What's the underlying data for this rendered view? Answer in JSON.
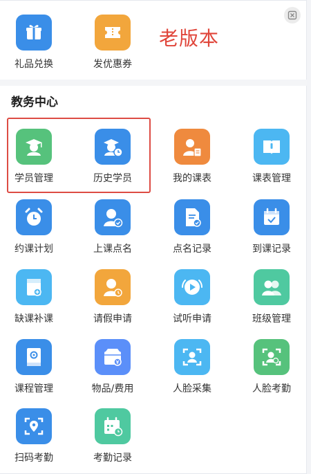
{
  "overlay": {
    "version_label": "老版本",
    "close_icon": "close-icon"
  },
  "colors": {
    "blue": "#3a8ee8",
    "sky": "#4cb7f2",
    "green": "#56c27c",
    "teal": "#4fc9a0",
    "orange": "#f2a63c",
    "deep_orange": "#ef8a3e",
    "indigo": "#5b8ff9",
    "highlight": "#dd4b43"
  },
  "top_items": [
    {
      "label": "礼品兑换",
      "icon": "gift-icon",
      "color": "#3a8ee8"
    },
    {
      "label": "发优惠券",
      "icon": "coupon-icon",
      "color": "#f2a63c"
    }
  ],
  "section": {
    "title": "教务中心",
    "items": [
      {
        "label": "学员管理",
        "icon": "student-icon",
        "color": "#56c27c"
      },
      {
        "label": "历史学员",
        "icon": "history-student-icon",
        "color": "#3a8ee8"
      },
      {
        "label": "我的课表",
        "icon": "my-schedule-icon",
        "color": "#ef8a3e"
      },
      {
        "label": "课表管理",
        "icon": "schedule-book-icon",
        "color": "#4cb7f2"
      },
      {
        "label": "约课计划",
        "icon": "alarm-clock-icon",
        "color": "#3a8ee8"
      },
      {
        "label": "上课点名",
        "icon": "attendance-user-icon",
        "color": "#3a8ee8"
      },
      {
        "label": "点名记录",
        "icon": "roll-call-record-icon",
        "color": "#3a8ee8"
      },
      {
        "label": "到课记录",
        "icon": "calendar-check-icon",
        "color": "#3a8ee8"
      },
      {
        "label": "缺课补课",
        "icon": "makeup-book-icon",
        "color": "#4cb7f2"
      },
      {
        "label": "请假申请",
        "icon": "leave-request-icon",
        "color": "#f2a63c"
      },
      {
        "label": "试听申请",
        "icon": "trial-play-icon",
        "color": "#4cb7f2"
      },
      {
        "label": "班级管理",
        "icon": "class-group-icon",
        "color": "#4fc9a0"
      },
      {
        "label": "课程管理",
        "icon": "course-book-icon",
        "color": "#3a8ee8"
      },
      {
        "label": "物品/费用",
        "icon": "goods-fee-icon",
        "color": "#5b8ff9"
      },
      {
        "label": "人脸采集",
        "icon": "face-capture-icon",
        "color": "#4cb7f2"
      },
      {
        "label": "人脸考勤",
        "icon": "face-attendance-icon",
        "color": "#56c27c"
      },
      {
        "label": "扫码考勤",
        "icon": "scan-attendance-icon",
        "color": "#3a8ee8"
      },
      {
        "label": "考勤记录",
        "icon": "attendance-calendar-icon",
        "color": "#4fc9a0"
      }
    ]
  }
}
